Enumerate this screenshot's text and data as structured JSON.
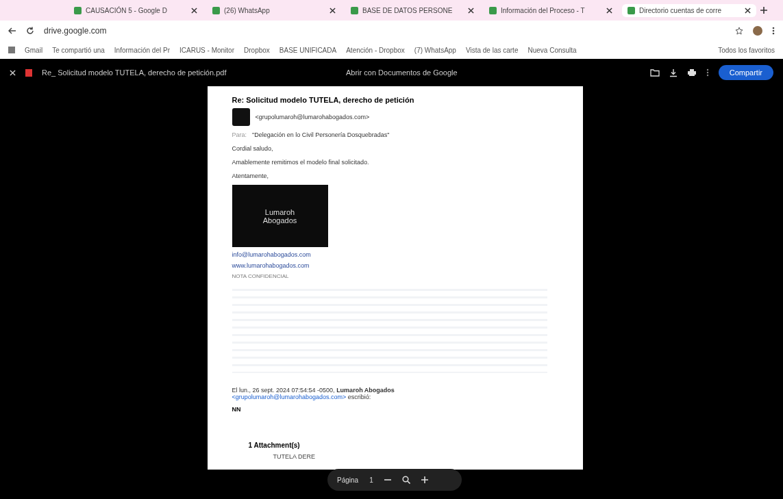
{
  "tabs": [
    {
      "title": "CAUSACIÓN 5 - Google D",
      "selected": false
    },
    {
      "title": "(26) WhatsApp",
      "selected": false
    },
    {
      "title": "BASE DE DATOS PERSONE",
      "selected": false
    },
    {
      "title": "Información del Proceso - T",
      "selected": false
    },
    {
      "title": "Directorio cuentas de corre",
      "selected": true
    }
  ],
  "address_bar": {
    "url": "drive.google.com"
  },
  "bookmarks": [
    {
      "label": "Gmail"
    },
    {
      "label": "Te compartió una"
    },
    {
      "label": "Información del Pr"
    },
    {
      "label": "ICARUS - Monitor"
    },
    {
      "label": "Dropbox"
    },
    {
      "label": "BASE UNIFICADA"
    },
    {
      "label": "Atención - Dropbox"
    },
    {
      "label": "(7) WhatsApp"
    },
    {
      "label": "Vista de las carte"
    },
    {
      "label": "Nueva Consulta"
    }
  ],
  "all_bookmarks": "Todos los favoritos",
  "viewer": {
    "file_name": "Re_ Solicitud modelo TUTELA, derecho de petición.pdf",
    "open_with": "Abrir con Documentos de Google",
    "share_button": "Compartir"
  },
  "email": {
    "subject": "Re: Solicitud modelo TUTELA, derecho de petición",
    "from": "<grupolumaroh@lumarohabogados.com>",
    "to_label": "Para:",
    "to": "\"Delegación en lo Civil Personería Dosquebradas\"",
    "body": [
      "Cordial saludo,",
      "Amablemente remitimos el modelo final solicitado.",
      "Atentamente,"
    ],
    "logo_lines": [
      "Lumaroh",
      "Abogados"
    ],
    "links": [
      "info@lumarohabogados.com",
      "www.lumarohabogados.com"
    ],
    "note": "NOTA CONFIDENCIAL",
    "quote_intro": "El lun., 26 sept. 2024 07:54:54 -0500, **Lumaroh Abogados**",
    "quote_email": "<grupolumaroh@lumarohabogados.com>",
    "quote_end": "escribió:",
    "short_text": "NN",
    "attachments_label": "1 Attachment(s)",
    "attachment_name": "TUTELA DERE"
  },
  "page_toolbar": {
    "label": "Página",
    "page": "1"
  }
}
